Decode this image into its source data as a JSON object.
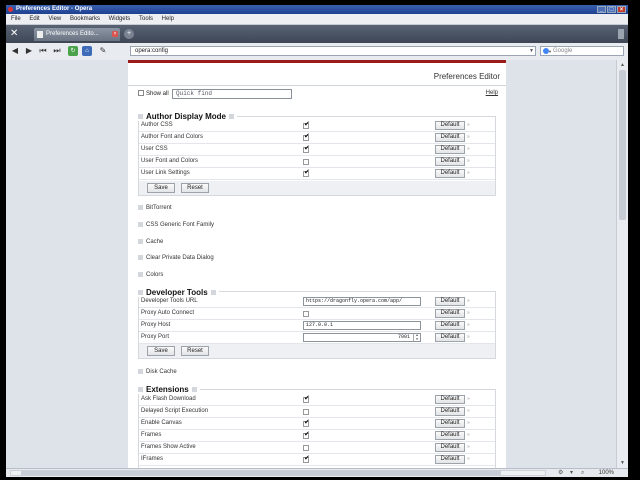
{
  "window": {
    "title": "Preferences Editor - Opera"
  },
  "menu": [
    "File",
    "Edit",
    "View",
    "Bookmarks",
    "Widgets",
    "Tools",
    "Help"
  ],
  "tab": {
    "label": "Preferences Edito..."
  },
  "address": {
    "url": "opera:config"
  },
  "search": {
    "placeholder": "Google"
  },
  "page": {
    "title": "Preferences Editor",
    "show_all": "Show all",
    "quick_find": "Quick find",
    "help": "Help",
    "default_label": "Default",
    "save_label": "Save",
    "reset_label": "Reset"
  },
  "author_display": {
    "title": "Author Display Mode",
    "rows": [
      {
        "label": "Author CSS",
        "checked": true
      },
      {
        "label": "Author Font and Colors",
        "checked": true
      },
      {
        "label": "User CSS",
        "checked": true
      },
      {
        "label": "User Font and Colors",
        "checked": false
      },
      {
        "label": "User Link Settings",
        "checked": true
      }
    ]
  },
  "collapsed_1": [
    "BitTorrent",
    "CSS Generic Font Family",
    "Cache",
    "Clear Private Data Dialog",
    "Colors"
  ],
  "developer_tools": {
    "title": "Developer Tools",
    "rows": [
      {
        "label": "Developer Tools URL",
        "type": "text",
        "value": "https://dragonfly.opera.com/app/"
      },
      {
        "label": "Proxy Auto Connect",
        "type": "check",
        "checked": false
      },
      {
        "label": "Proxy Host",
        "type": "text",
        "value": "127.0.0.1"
      },
      {
        "label": "Proxy Port",
        "type": "number",
        "value": "7001"
      }
    ]
  },
  "collapsed_2": [
    "Disk Cache"
  ],
  "extensions": {
    "title": "Extensions",
    "rows": [
      {
        "label": "Ask Flash Download",
        "checked": true
      },
      {
        "label": "Delayed Script Execution",
        "checked": false
      },
      {
        "label": "Enable Canvas",
        "checked": true
      },
      {
        "label": "Frames",
        "checked": true
      },
      {
        "label": "Frames Show Active",
        "checked": false
      },
      {
        "label": "IFrames",
        "checked": true
      }
    ]
  },
  "status": {
    "zoom": "100%"
  }
}
